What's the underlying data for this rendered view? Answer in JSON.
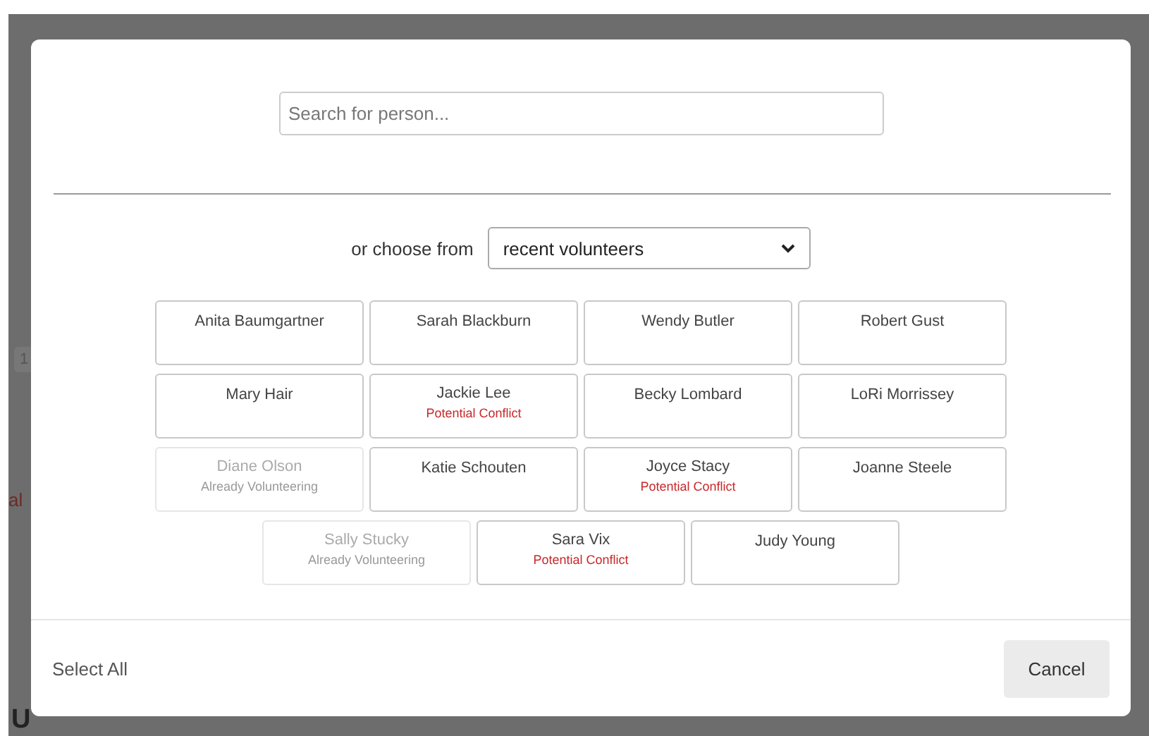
{
  "background": {
    "fragments": [
      {
        "kind": "pill",
        "text": "1"
      },
      {
        "kind": "link",
        "text": "al"
      },
      {
        "kind": "heading",
        "text": "U"
      }
    ]
  },
  "dialog": {
    "search": {
      "placeholder": "Search for person..."
    },
    "chooser": {
      "label": "or choose from",
      "value": "recent volunteers"
    },
    "people": [
      {
        "name": "Anita Baumgartner",
        "kind": "normal",
        "disabled": false
      },
      {
        "name": "Sarah Blackburn",
        "kind": "normal",
        "disabled": false
      },
      {
        "name": "Wendy Butler",
        "kind": "normal",
        "disabled": false
      },
      {
        "name": "Robert Gust",
        "kind": "normal",
        "disabled": false
      },
      {
        "name": "Mary Hair",
        "kind": "normal",
        "disabled": false
      },
      {
        "name": "Jackie Lee",
        "kind": "conflict",
        "note": "Potential Conflict",
        "disabled": false
      },
      {
        "name": "Becky Lombard",
        "kind": "normal",
        "disabled": false
      },
      {
        "name": "LoRi Morrissey",
        "kind": "normal",
        "disabled": false
      },
      {
        "name": "Diane Olson",
        "kind": "volunteering",
        "note": "Already Volunteering",
        "disabled": true
      },
      {
        "name": "Katie Schouten",
        "kind": "normal",
        "disabled": false
      },
      {
        "name": "Joyce Stacy",
        "kind": "conflict",
        "note": "Potential Conflict",
        "disabled": false
      },
      {
        "name": "Joanne Steele",
        "kind": "normal",
        "disabled": false
      },
      {
        "name": "Sally Stucky",
        "kind": "volunteering",
        "note": "Already Volunteering",
        "disabled": true
      },
      {
        "name": "Sara Vix",
        "kind": "conflict",
        "note": "Potential Conflict",
        "disabled": false
      },
      {
        "name": "Judy Young",
        "kind": "normal",
        "disabled": false
      }
    ],
    "footer": {
      "select_all": "Select All",
      "cancel": "Cancel"
    }
  }
}
